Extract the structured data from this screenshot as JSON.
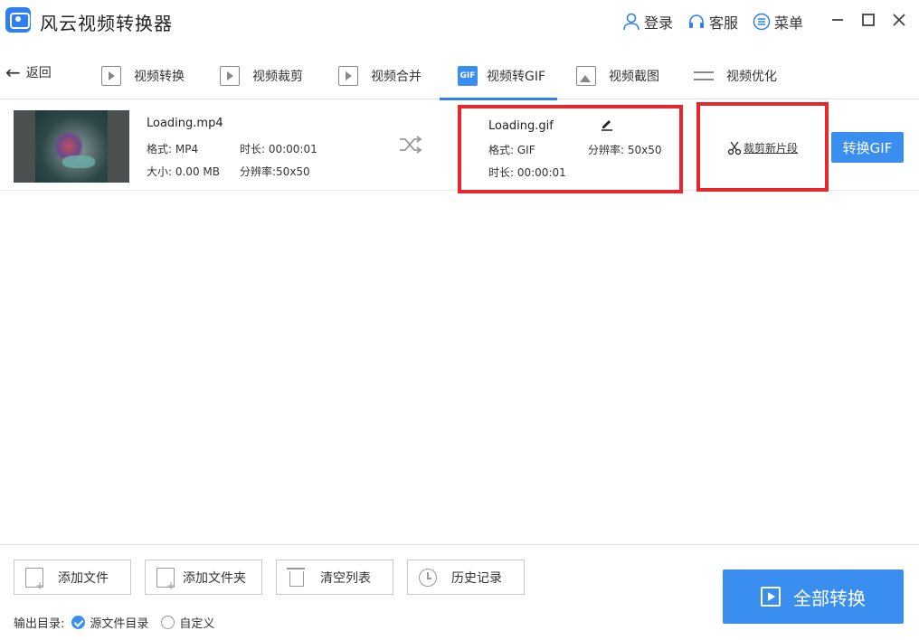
{
  "app": {
    "title": "风云视频转换器"
  },
  "titlebar": {
    "login": "登录",
    "service": "客服",
    "menu": "菜单"
  },
  "nav": {
    "back": "返回",
    "tabs": [
      {
        "label": "视频转换",
        "icon": "video-convert-icon"
      },
      {
        "label": "视频裁剪",
        "icon": "video-crop-icon"
      },
      {
        "label": "视频合并",
        "icon": "video-merge-icon"
      },
      {
        "label": "视频转GIF",
        "icon": "gif-icon",
        "badge": "GIF",
        "active": true
      },
      {
        "label": "视频截图",
        "icon": "image-icon"
      },
      {
        "label": "视频优化",
        "icon": "sliders-icon"
      }
    ]
  },
  "file": {
    "source": {
      "name": "Loading.mp4",
      "format": "格式: MP4",
      "duration": "时长: 00:00:01",
      "size": "大小: 0.00 MB",
      "resolution": "分辨率:50x50"
    },
    "output": {
      "name": "Loading.gif",
      "format": "格式: GIF",
      "resolution": "分辨率: 50x50",
      "duration": "时长: 00:00:01"
    },
    "cut_link": "裁剪新片段",
    "convert_button": "转换GIF"
  },
  "bottom": {
    "add_file": "添加文件",
    "add_folder": "添加文件夹",
    "clear_list": "清空列表",
    "history": "历史记录",
    "convert_all": "全部转换",
    "output_dir_label": "输出目录:",
    "source_dir": "源文件目录",
    "custom": "自定义"
  },
  "colors": {
    "accent": "#3a8ef0",
    "highlight": "#e8262d"
  }
}
